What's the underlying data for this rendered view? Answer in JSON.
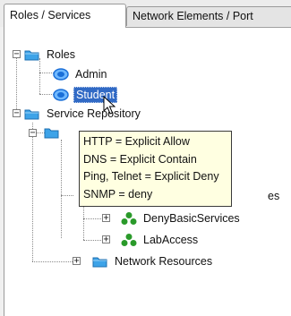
{
  "tabs": [
    {
      "label": "Roles / Services",
      "active": true
    },
    {
      "label": "Network Elements / Port",
      "active": false
    }
  ],
  "tree": {
    "roles": {
      "label": "Roles",
      "expander": "−"
    },
    "admin": {
      "label": "Admin"
    },
    "student": {
      "label": "Student",
      "selected": true
    },
    "service_repository": {
      "label": "Service Repository",
      "expander": "−"
    },
    "hidden_node_expander": "−",
    "hidden_row_suffix": "es",
    "deny_basic_services": {
      "label": "DenyBasicServices",
      "expander": "+"
    },
    "lab_access": {
      "label": "LabAccess",
      "expander": "+"
    },
    "network_resources": {
      "label": "Network Resources",
      "expander": "+"
    }
  },
  "tooltip": {
    "lines": [
      "HTTP = Explicit Allow",
      "DNS = Explicit Contain",
      "Ping, Telnet = Explicit Deny",
      "SNMP = deny"
    ]
  },
  "colors": {
    "selection": "#316ac5",
    "folder": "#3da3e8",
    "role_icon": "#1a6fd8",
    "service_icon": "#2a9a2a",
    "tooltip_bg": "#ffffe1"
  }
}
